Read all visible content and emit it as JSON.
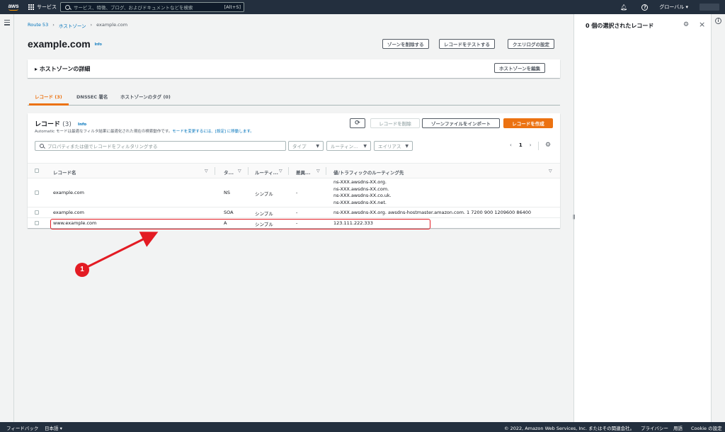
{
  "topnav": {
    "logo": "aws",
    "services_label": "サービス",
    "search_placeholder": "サービス、特徴、ブログ、およびドキュメントなどを検索",
    "search_shortcut": "[Alt+S]",
    "region_label": "グローバル ▾"
  },
  "breadcrumb": {
    "root": "Route 53",
    "zones": "ホストゾーン",
    "current": "example.com"
  },
  "page": {
    "title": "example.com",
    "info": "Info",
    "btn_delete_zone": "ゾーンを削除する",
    "btn_test_record": "レコードをテストする",
    "btn_query_log": "クエリログの設定"
  },
  "hosted_zone_details": {
    "title": "ホストゾーンの詳細",
    "edit_button": "ホストゾーンを編集"
  },
  "tabs": [
    {
      "label": "レコード (3)"
    },
    {
      "label": "DNSSEC 署名"
    },
    {
      "label": "ホストゾーンのタグ (0)"
    }
  ],
  "records": {
    "title": "レコード",
    "count": "(3)",
    "info": "Info",
    "description_prefix": "Automatic モードは最適なフィルタ結果に最適化された現在の検索動作です。",
    "description_link": "モードを変更するには、[設定] に移動します。",
    "btn_refresh": "⟳",
    "btn_delete_record": "レコードを削除",
    "btn_import": "ゾーンファイルをインポート",
    "btn_create": "レコードを作成",
    "filter_placeholder": "プロパティまたは値でレコードをフィルタリングする",
    "filter_type": "タイプ",
    "filter_routing": "ルーティン...",
    "filter_alias": "エイリアス",
    "page_current": "1",
    "columns": [
      "レコード名",
      "タ...",
      "ルーティ...",
      "差異...",
      "値/トラフィックのルーティング先"
    ],
    "rows": [
      {
        "name": "example.com",
        "type": "NS",
        "routing": "シンプル",
        "diff": "-",
        "values": [
          "ns-XXX.awsdns-XX.org.",
          "ns-XXX.awsdns-XX.com.",
          "ns-XXX.awsdns-XX.co.uk.",
          "ns-XXX.awsdns-XX.net."
        ]
      },
      {
        "name": "example.com",
        "type": "SOA",
        "routing": "シンプル",
        "diff": "-",
        "values": [
          "ns-XXX.awsdns-XX.org. awsdns-hostmaster.amazon.com. 1 7200 900 1209600 86400"
        ]
      },
      {
        "name": "www.example.com",
        "type": "A",
        "routing": "シンプル",
        "diff": "-",
        "values": [
          "123.111.222.333"
        ]
      }
    ]
  },
  "right_panel": {
    "title": "0 個の選択されたレコード"
  },
  "annotation": {
    "marker_label": "1",
    "color": "#e31b23"
  },
  "footer": {
    "feedback": "フィードバック",
    "language": "日本語 ▾",
    "copyright": "© 2022, Amazon Web Services, Inc. またはその関連会社。",
    "privacy": "プライバシー",
    "terms": "用語",
    "cookies": "Cookie の設定"
  },
  "colors": {
    "nav_bg": "#232f3e",
    "accent_orange": "#ec7211",
    "link_blue": "#0073bb"
  }
}
